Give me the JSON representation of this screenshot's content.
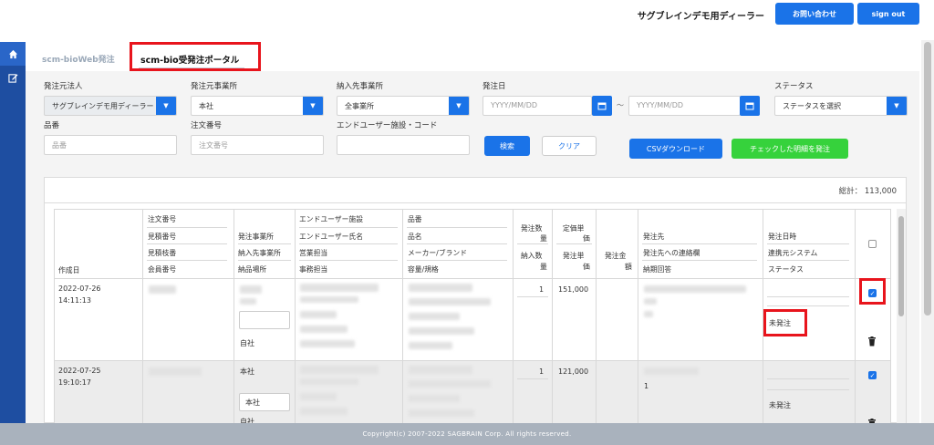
{
  "header": {
    "dealer_name": "サグブレインデモ用ディーラー",
    "contact_label": "お問い合わせ",
    "signout_label": "sign out"
  },
  "sidebar": {
    "items": [
      "home-icon",
      "edit-icon"
    ]
  },
  "tabs": [
    {
      "label": "scm-bioWeb発注"
    },
    {
      "label": "scm-bio受発注ポータル"
    }
  ],
  "filters": {
    "order_source_label": "発注元法人",
    "order_source_value": "サグブレインデモ用ディーラー",
    "order_office_label": "発注元事業所",
    "order_office_value": "本社",
    "delivery_office_label": "納入先事業所",
    "delivery_office_value": "全事業所",
    "order_date_label": "発注日",
    "date_placeholder": "YYYY/MM/DD",
    "date_sep": "〜",
    "status_label": "ステータス",
    "status_value": "ステータスを選択",
    "item_no_label": "品番",
    "item_no_placeholder": "品番",
    "order_no_label": "注文番号",
    "order_no_placeholder": "注文番号",
    "enduser_label": "エンドユーザー施設・コード",
    "search_label": "検索",
    "clear_label": "クリア",
    "csv_label": "CSVダウンロード",
    "order_checked_label": "チェックした明細を発注"
  },
  "summary": {
    "total_label": "総計：",
    "total_value": "113,000"
  },
  "table": {
    "headers": {
      "created": "作成日",
      "col2": [
        "注文番号",
        "見積番号",
        "見積枝番",
        "会員番号"
      ],
      "col3": [
        "発注事業所",
        "納入先事業所",
        "納品場所"
      ],
      "col4": [
        "エンドユーザー施設",
        "エンドユーザー氏名",
        "営業担当",
        "事務担当"
      ],
      "col5": [
        "品番",
        "品名",
        "メーカー/ブランド",
        "容量/規格"
      ],
      "qty": [
        "発注数",
        "量",
        "納入数",
        "量"
      ],
      "price": [
        "定価単",
        "価",
        "発注単",
        "価"
      ],
      "amount": [
        "発注金",
        "額"
      ],
      "dest": [
        "発注先",
        "発注先への連絡欄",
        "納期回答"
      ],
      "status": [
        "発注日時",
        "連携元システム",
        "ステータス"
      ]
    },
    "rows": [
      {
        "created_date": "2022-07-26",
        "created_time": "14:11:13",
        "delivery_place": "自社",
        "qty": "1",
        "price": "151,000",
        "status": "未発注",
        "checked": true
      },
      {
        "created_date": "2022-07-25",
        "created_time": "19:10:17",
        "order_office": "本社",
        "delivery_office": "本社",
        "delivery_place": "自社",
        "qty": "1",
        "price": "121,000",
        "dest_note": "1",
        "status": "未発注",
        "checked": true
      }
    ]
  },
  "footer": {
    "copyright": "Copyright(c) 2007-2022 SAGBRAIN Corp. All rights reserved."
  },
  "colors": {
    "primary": "#1a73e8",
    "sidebar": "#1e4ea1",
    "success": "#36d23c",
    "highlight": "#e8141c",
    "footer": "#a9b2bd"
  }
}
